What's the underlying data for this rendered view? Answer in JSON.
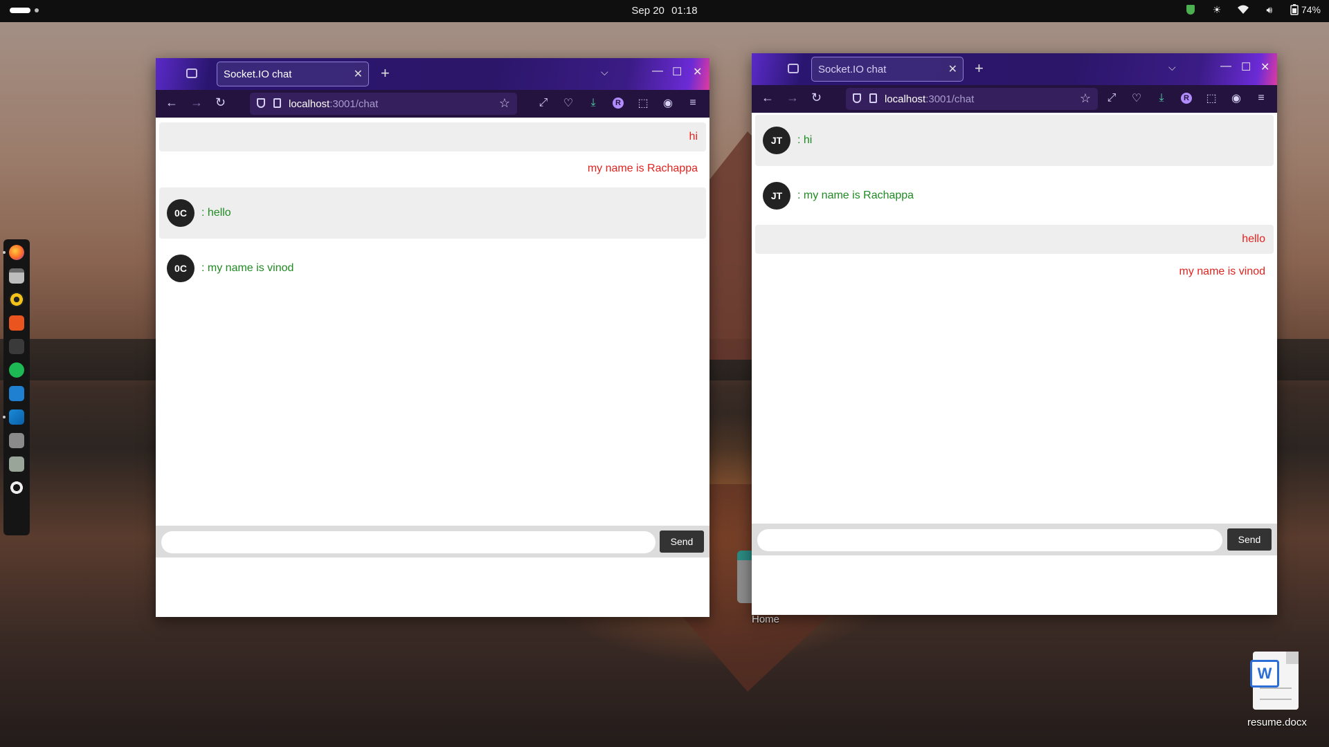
{
  "topbar": {
    "date": "Sep 20",
    "time": "01:18",
    "battery": "74%"
  },
  "dock": {
    "items": [
      "firefox-icon",
      "files-icon",
      "rhythmbox-icon",
      "app-center-icon",
      "terminal-icon",
      "spotify-icon",
      "system-monitor-icon",
      "vscode-icon",
      "drive-icon",
      "trash-icon",
      "show-apps-icon"
    ]
  },
  "window_left": {
    "tab_title": "Socket.IO chat",
    "url_host": "localhost",
    "url_rest": ":3001/chat",
    "messages": [
      {
        "side": "right",
        "text": "hi"
      },
      {
        "side": "right",
        "text": "my name is Rachappa"
      },
      {
        "side": "left",
        "avatar": "0C",
        "text": ": hello"
      },
      {
        "side": "left",
        "avatar": "0C",
        "text": ": my name is vinod"
      }
    ],
    "input_value": "",
    "send_label": "Send"
  },
  "window_right": {
    "tab_title": "Socket.IO chat",
    "url_host": "localhost",
    "url_rest": ":3001/chat",
    "messages": [
      {
        "side": "left",
        "avatar": "JT",
        "text": ": hi"
      },
      {
        "side": "left",
        "avatar": "JT",
        "text": ": my name is Rachappa"
      },
      {
        "side": "right",
        "text": "hello"
      },
      {
        "side": "right",
        "text": "my name is vinod"
      }
    ],
    "input_value": "",
    "send_label": "Send"
  },
  "desktop": {
    "home_label": "Home",
    "file_label": "resume.docx"
  },
  "colors": {
    "own_message": "#e0231f",
    "other_message": "#1f8a22",
    "titlebar_purple": "#2b1669"
  }
}
